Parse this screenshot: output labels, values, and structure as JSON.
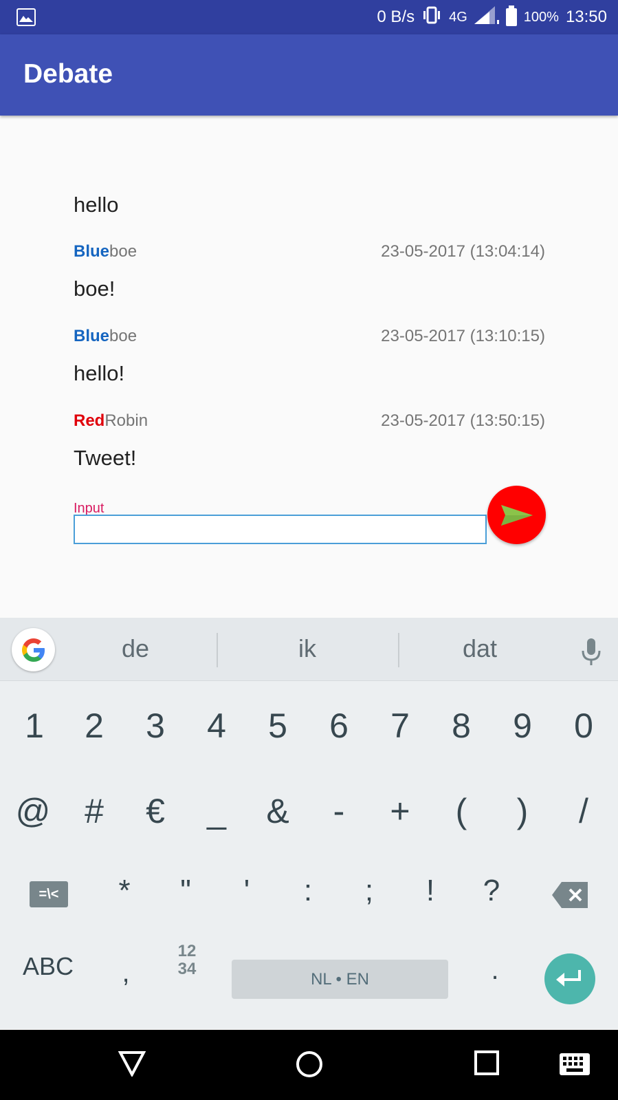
{
  "status_bar": {
    "net_speed": "0 B/s",
    "network": "4G",
    "battery": "100%",
    "time": "13:50"
  },
  "app_bar": {
    "title": "Debate"
  },
  "messages": {
    "first": {
      "text": "hello"
    },
    "items": [
      {
        "team": "Blue",
        "user": "boe",
        "timestamp": "23-05-2017 (13:04:14)",
        "text": "boe!"
      },
      {
        "team": "Blue",
        "user": "boe",
        "timestamp": "23-05-2017 (13:10:15)",
        "text": "hello!"
      },
      {
        "team": "Red",
        "user": "Robin",
        "timestamp": "23-05-2017 (13:50:15)",
        "text": "Tweet!"
      }
    ]
  },
  "input": {
    "label": "Input",
    "value": ""
  },
  "keyboard": {
    "suggestions": [
      "de",
      "ik",
      "dat"
    ],
    "row1": [
      "1",
      "2",
      "3",
      "4",
      "5",
      "6",
      "7",
      "8",
      "9",
      "0"
    ],
    "row2": [
      "@",
      "#",
      "€",
      "_",
      "&",
      "-",
      "+",
      "(",
      ")",
      "/"
    ],
    "row3_symbols_key": "=\\<",
    "row3": [
      "*",
      "\"",
      "'",
      ":",
      ";",
      "!",
      "?"
    ],
    "abc_key": "ABC",
    "comma_key": ",",
    "numpad_key": "12\n34",
    "space_label": "NL • EN",
    "period_key": "."
  },
  "colors": {
    "status_bar": "#303f9f",
    "app_bar": "#3f51b5",
    "blue_team": "#1565c0",
    "red_team": "#e0000b",
    "send_button": "#ff0000",
    "send_arrow": "#8bc34a",
    "input_label": "#d81b60",
    "enter_key": "#4db6ac"
  }
}
